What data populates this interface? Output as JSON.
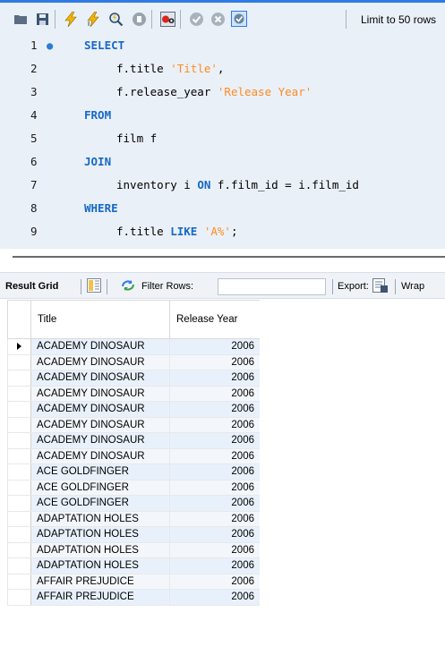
{
  "toolbar": {
    "icons": [
      "open-folder-icon",
      "save-icon",
      "execute-lightning-icon",
      "execute-current-lightning-icon",
      "explain-magnifier-icon",
      "stop-icon",
      "toggle-errors-icon",
      "commit-check-icon",
      "rollback-icon",
      "autocommit-icon"
    ],
    "limit_label": "Limit to 50 rows"
  },
  "editor": {
    "lines": [
      {
        "n": "1",
        "parts": [
          {
            "t": "SELECT",
            "c": "kw"
          }
        ]
      },
      {
        "n": "2",
        "parts": [
          {
            "t": "f.title ",
            "c": ""
          },
          {
            "t": "'Title'",
            "c": "str"
          },
          {
            "t": ",",
            "c": ""
          }
        ]
      },
      {
        "n": "3",
        "parts": [
          {
            "t": "f.release_year ",
            "c": ""
          },
          {
            "t": "'Release Year'",
            "c": "str"
          }
        ]
      },
      {
        "n": "4",
        "parts": [
          {
            "t": "FROM",
            "c": "kw"
          }
        ]
      },
      {
        "n": "5",
        "parts": [
          {
            "t": "film f",
            "c": ""
          }
        ]
      },
      {
        "n": "6",
        "parts": [
          {
            "t": "JOIN",
            "c": "kw"
          }
        ]
      },
      {
        "n": "7",
        "parts": [
          {
            "t": "inventory i ",
            "c": ""
          },
          {
            "t": "ON",
            "c": "kw"
          },
          {
            "t": " f.film_id = i.film_id",
            "c": ""
          }
        ]
      },
      {
        "n": "8",
        "parts": [
          {
            "t": "WHERE",
            "c": "kw"
          }
        ]
      },
      {
        "n": "9",
        "parts": [
          {
            "t": "f.title ",
            "c": ""
          },
          {
            "t": "LIKE",
            "c": "kw"
          },
          {
            "t": " ",
            "c": ""
          },
          {
            "t": "'A%'",
            "c": "str"
          },
          {
            "t": ";",
            "c": ""
          }
        ]
      }
    ]
  },
  "results_toolbar": {
    "result_grid_label": "Result Grid",
    "filter_label": "Filter Rows:",
    "filter_value": "",
    "export_label": "Export:",
    "wrap_label": "Wrap"
  },
  "grid": {
    "columns": [
      "Title",
      "Release Year"
    ],
    "rows": [
      [
        "ACADEMY DINOSAUR",
        "2006"
      ],
      [
        "ACADEMY DINOSAUR",
        "2006"
      ],
      [
        "ACADEMY DINOSAUR",
        "2006"
      ],
      [
        "ACADEMY DINOSAUR",
        "2006"
      ],
      [
        "ACADEMY DINOSAUR",
        "2006"
      ],
      [
        "ACADEMY DINOSAUR",
        "2006"
      ],
      [
        "ACADEMY DINOSAUR",
        "2006"
      ],
      [
        "ACADEMY DINOSAUR",
        "2006"
      ],
      [
        "ACE GOLDFINGER",
        "2006"
      ],
      [
        "ACE GOLDFINGER",
        "2006"
      ],
      [
        "ACE GOLDFINGER",
        "2006"
      ],
      [
        "ADAPTATION HOLES",
        "2006"
      ],
      [
        "ADAPTATION HOLES",
        "2006"
      ],
      [
        "ADAPTATION HOLES",
        "2006"
      ],
      [
        "ADAPTATION HOLES",
        "2006"
      ],
      [
        "AFFAIR PREJUDICE",
        "2006"
      ],
      [
        "AFFAIR PREJUDICE",
        "2006"
      ]
    ]
  }
}
